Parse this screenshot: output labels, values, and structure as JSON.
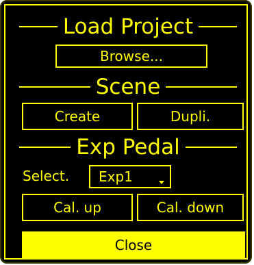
{
  "load_project": {
    "title": "Load Project",
    "browse_label": "Browse..."
  },
  "scene": {
    "title": "Scene",
    "create_label": "Create",
    "duplicate_label": "Dupli."
  },
  "exp_pedal": {
    "title": "Exp Pedal",
    "select_label": "Select.",
    "selected_value": "Exp1",
    "cal_up_label": "Cal. up",
    "cal_down_label": "Cal. down"
  },
  "close_label": "Close",
  "icons": {
    "dropdown": "chevron-down-icon"
  },
  "colors": {
    "background": "#000000",
    "accent": "#ffff00"
  }
}
